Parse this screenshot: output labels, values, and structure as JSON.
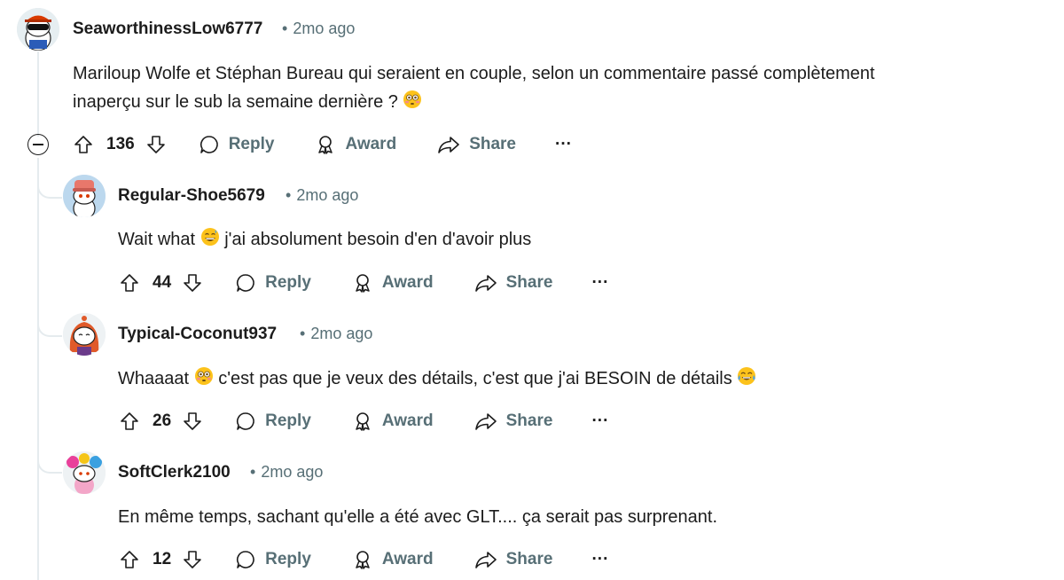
{
  "comments": [
    {
      "username": "SeaworthinessLow6777",
      "time": "2mo ago",
      "text_1": "Mariloup Wolfe et Stéphan Bureau qui seraient en couple, selon un commentaire passé complètement",
      "text_2": "inaperçu sur le sub la semaine dernière ?",
      "score": "136",
      "reply": "Reply",
      "award": "Award",
      "share": "Share",
      "more": "···"
    },
    {
      "username": "Regular-Shoe5679",
      "time": "2mo ago",
      "text_a": "Wait what",
      "text_b": "j'ai absolument besoin d'en d'avoir plus",
      "score": "44",
      "reply": "Reply",
      "award": "Award",
      "share": "Share",
      "more": "···"
    },
    {
      "username": "Typical-Coconut937",
      "time": "2mo ago",
      "text_a": "Whaaaat",
      "text_b": "c'est pas que je veux des détails, c'est que j'ai BESOIN de détails",
      "score": "26",
      "reply": "Reply",
      "award": "Award",
      "share": "Share",
      "more": "···"
    },
    {
      "username": "SoftClerk2100",
      "time": "2mo ago",
      "text": "En même temps, sachant qu'elle a été avec GLT.... ça serait pas surprenant.",
      "score": "12",
      "reply": "Reply",
      "award": "Award",
      "share": "Share",
      "more": "···"
    }
  ],
  "separator": "•"
}
